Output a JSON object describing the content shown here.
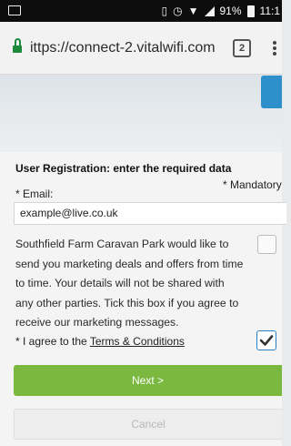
{
  "status_bar": {
    "battery": "91%",
    "time": "11:1"
  },
  "browser": {
    "url": "ittps://connect-2.vitalwifi.com",
    "tab_count": "2"
  },
  "form": {
    "heading": "User Registration: enter the required data",
    "mandatory_note": "* Mandatory",
    "email_label": "* Email:",
    "email_value": "example@live.co.uk",
    "marketing_text": "Southfield Farm Caravan Park would like to send you marketing deals and offers from time to time. Your details will not be shared with any other parties. Tick this box if you agree to receive our marketing messages.",
    "marketing_checked": false,
    "terms_prefix": "* I agree to the ",
    "terms_link": "Terms & Conditions",
    "terms_checked": true,
    "next_label": "Next >",
    "cancel_label": "Cancel"
  },
  "colors": {
    "accent_blue": "#2f8fcb",
    "next_green": "#7ab840",
    "lock_green": "#1c8a3a"
  }
}
